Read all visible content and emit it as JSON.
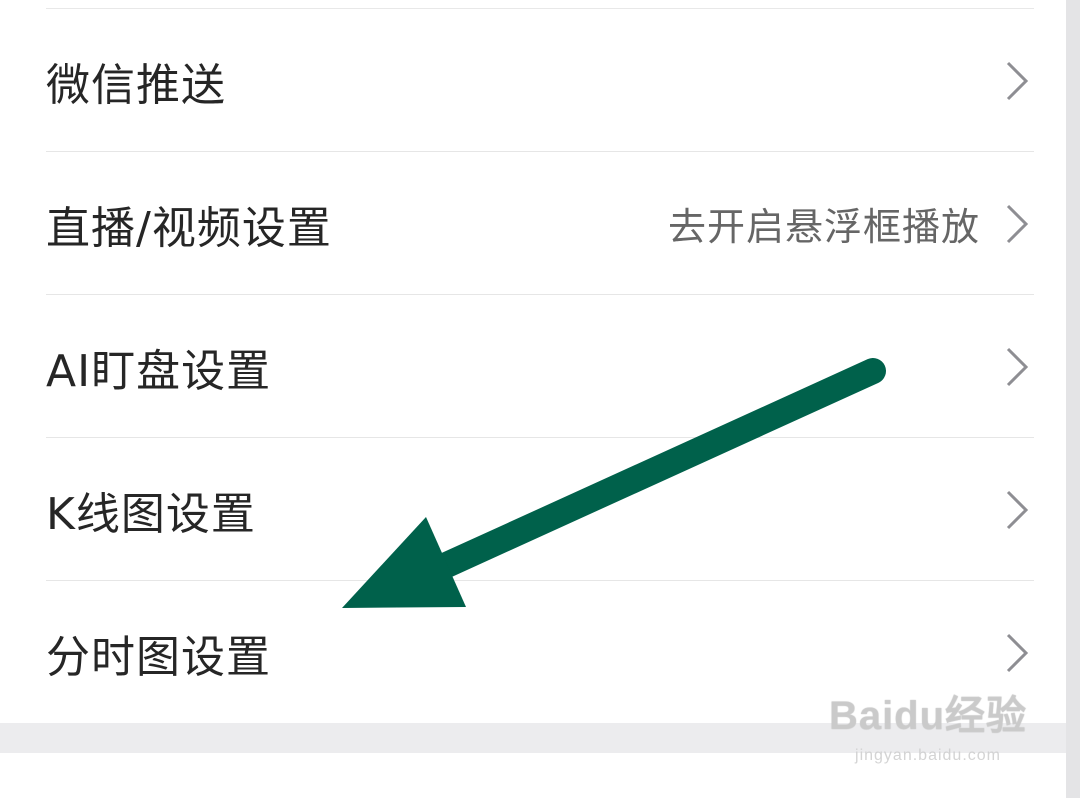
{
  "settings_list": [
    {
      "label": "微信推送",
      "value": ""
    },
    {
      "label": "直播/视频设置",
      "value": "去开启悬浮框播放"
    },
    {
      "label": "AI盯盘设置",
      "value": ""
    },
    {
      "label": "K线图设置",
      "value": ""
    },
    {
      "label": "分时图设置",
      "value": ""
    }
  ],
  "annotation": {
    "arrow_color": "#00614B",
    "points_to": "分时图设置"
  },
  "watermark": {
    "brand": "Baidu经验",
    "url": "jingyan.baidu.com"
  },
  "icons": {
    "chevron": "chevron-right-icon",
    "paw": "baidu-paw-icon"
  }
}
